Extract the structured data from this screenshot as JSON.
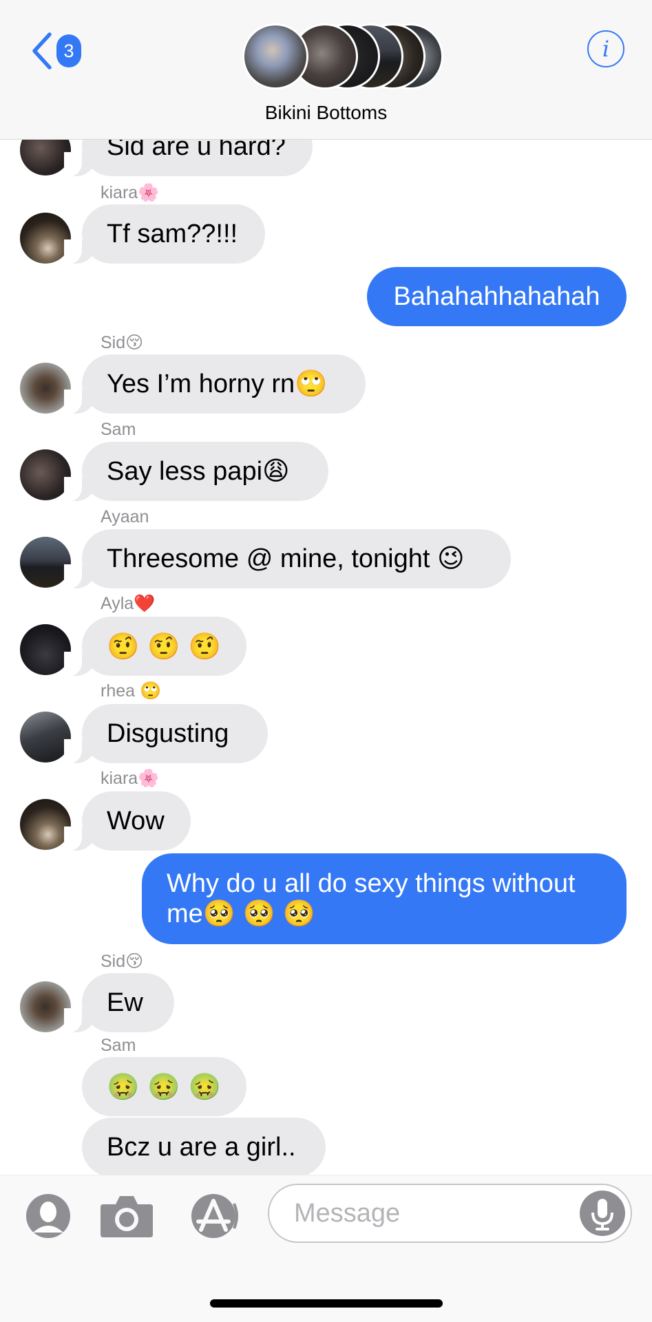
{
  "header": {
    "back_badge": "3",
    "group_name": "Bikini Bottoms",
    "info_glyph": "i"
  },
  "messages": [
    {
      "sender": "",
      "text": "Sid are u hard?",
      "direction": "received"
    },
    {
      "sender": "kiara🌸",
      "text": "Tf sam??!!!",
      "direction": "received"
    },
    {
      "sender": "",
      "text": "Bahahahhahahah",
      "direction": "sent"
    },
    {
      "sender": "Sid😚",
      "text": "Yes I’m horny rn🙄",
      "direction": "received"
    },
    {
      "sender": "Sam",
      "text": "Say less papi😩",
      "direction": "received"
    },
    {
      "sender": "Ayaan",
      "text": "Threesome @ mine, tonight 😉",
      "direction": "received"
    },
    {
      "sender": "Ayla❤️",
      "text": "🤨 🤨 🤨",
      "direction": "received"
    },
    {
      "sender": "rhea 🙄",
      "text": "Disgusting",
      "direction": "received"
    },
    {
      "sender": "kiara🌸",
      "text": "Wow",
      "direction": "received"
    },
    {
      "sender": "",
      "text_line1": "Why do u all do sexy things without",
      "text_line2": "me🥺 🥺 🥺",
      "direction": "sent"
    },
    {
      "sender": "Sid😚",
      "text": "Ew",
      "direction": "received"
    },
    {
      "sender": "Sam",
      "text": "🤢 🤢 🤢",
      "direction": "received"
    },
    {
      "sender": "",
      "text": "Bcz u are a girl..",
      "direction": "received"
    }
  ],
  "input": {
    "placeholder": "Message"
  },
  "colors": {
    "accent": "#3478f6",
    "received_bubble": "#e9e9eb",
    "header_bg": "#f7f7f7"
  }
}
